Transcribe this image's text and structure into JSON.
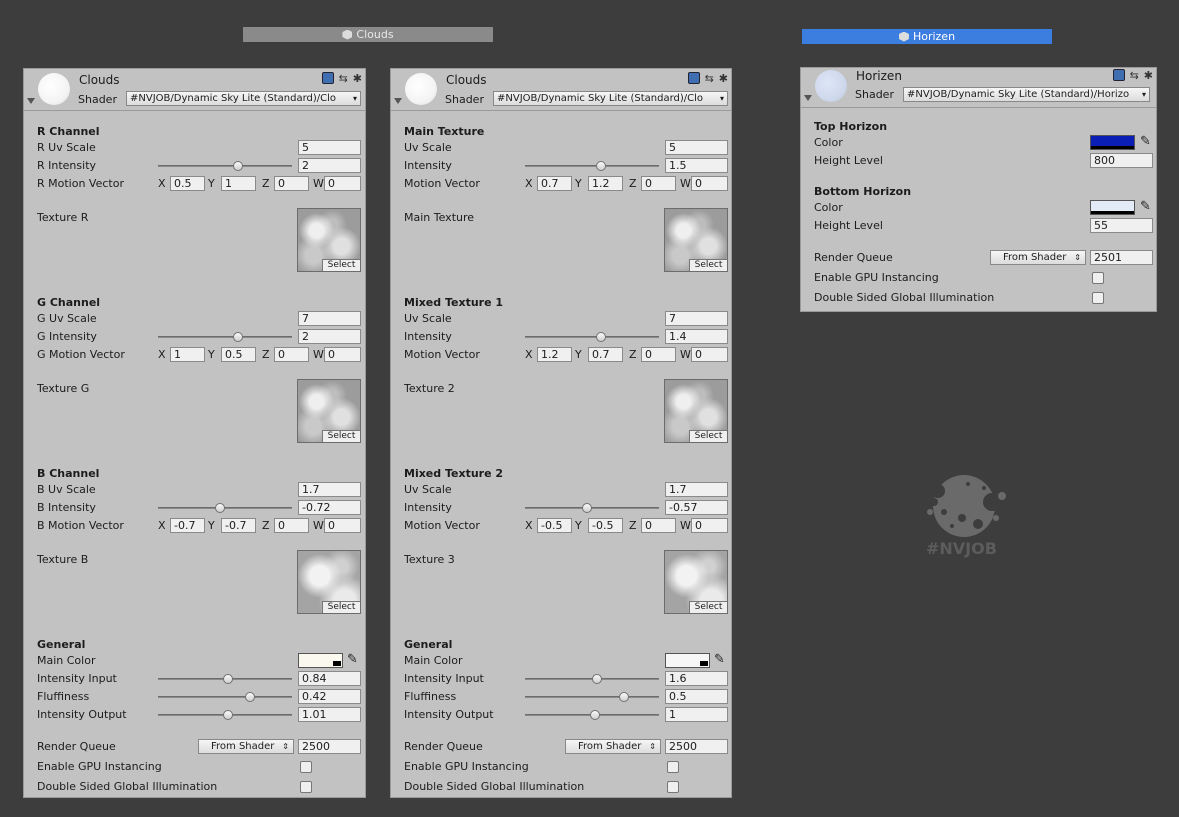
{
  "headers": [
    {
      "label": "Clouds"
    },
    {
      "label": "Horizen"
    }
  ],
  "panels": [
    {
      "name": "Clouds",
      "shader_label": "Shader",
      "shader": "#NVJOB/Dynamic Sky Lite (Standard)/Clo",
      "sections": [
        {
          "title": "R Channel",
          "uv_label": "R Uv Scale",
          "uv": "5",
          "int_label": "R Intensity",
          "int": "2",
          "int_frac": 0.6,
          "mv_label": "R Motion Vector",
          "mv": [
            "0.5",
            "1",
            "0",
            "0"
          ],
          "tex_label": "Texture R",
          "tex_style": "a",
          "select": "Select"
        },
        {
          "title": "G Channel",
          "uv_label": "G Uv Scale",
          "uv": "7",
          "int_label": "G Intensity",
          "int": "2",
          "int_frac": 0.6,
          "mv_label": "G Motion Vector",
          "mv": [
            "1",
            "0.5",
            "0",
            "0"
          ],
          "tex_label": "Texture G",
          "tex_style": "a",
          "select": "Select"
        },
        {
          "title": "B Channel",
          "uv_label": "B Uv Scale",
          "uv": "1.7",
          "int_label": "B Intensity",
          "int": "-0.72",
          "int_frac": 0.46,
          "mv_label": "B Motion Vector",
          "mv": [
            "-0.7",
            "-0.7",
            "0",
            "0"
          ],
          "tex_label": "Texture B",
          "tex_style": "b",
          "select": "Select"
        }
      ],
      "general": {
        "title": "General",
        "color_label": "Main Color",
        "color": "#fbf8ef",
        "sliders": [
          {
            "label": "Intensity Input",
            "value": "0.84",
            "frac": 0.52
          },
          {
            "label": "Fluffiness",
            "value": "0.42",
            "frac": 0.69
          },
          {
            "label": "Intensity Output",
            "value": "1.01",
            "frac": 0.52
          }
        ]
      },
      "render_queue_label": "Render Queue",
      "render_queue_mode": "From Shader",
      "render_queue": "2500",
      "gpu_label": "Enable GPU Instancing",
      "dsgi_label": "Double Sided Global Illumination"
    },
    {
      "name": "Clouds",
      "shader_label": "Shader",
      "shader": "#NVJOB/Dynamic Sky Lite (Standard)/Clo",
      "sections": [
        {
          "title": "Main Texture",
          "uv_label": "Uv Scale",
          "uv": "5",
          "int_label": "Intensity",
          "int": "1.5",
          "int_frac": 0.57,
          "mv_label": "Motion Vector",
          "mv": [
            "0.7",
            "1.2",
            "0",
            "0"
          ],
          "tex_label": "Main Texture",
          "tex_style": "a",
          "select": "Select"
        },
        {
          "title": "Mixed Texture 1",
          "uv_label": "Uv Scale",
          "uv": "7",
          "int_label": "Intensity",
          "int": "1.4",
          "int_frac": 0.57,
          "mv_label": "Motion Vector",
          "mv": [
            "1.2",
            "0.7",
            "0",
            "0"
          ],
          "tex_label": "Texture 2",
          "tex_style": "a",
          "select": "Select"
        },
        {
          "title": "Mixed Texture 2",
          "uv_label": "Uv Scale",
          "uv": "1.7",
          "int_label": "Intensity",
          "int": "-0.57",
          "int_frac": 0.46,
          "mv_label": "Motion Vector",
          "mv": [
            "-0.5",
            "-0.5",
            "0",
            "0"
          ],
          "tex_label": "Texture 3",
          "tex_style": "b",
          "select": "Select"
        }
      ],
      "general": {
        "title": "General",
        "color_label": "Main Color",
        "color": "#f7f7f7",
        "sliders": [
          {
            "label": "Intensity Input",
            "value": "1.6",
            "frac": 0.54
          },
          {
            "label": "Fluffiness",
            "value": "0.5",
            "frac": 0.74
          },
          {
            "label": "Intensity Output",
            "value": "1",
            "frac": 0.52
          }
        ]
      },
      "render_queue_label": "Render Queue",
      "render_queue_mode": "From Shader",
      "render_queue": "2500",
      "gpu_label": "Enable GPU Instancing",
      "dsgi_label": "Double Sided Global Illumination"
    }
  ],
  "horizon": {
    "name": "Horizen",
    "shader_label": "Shader",
    "shader": "#NVJOB/Dynamic Sky Lite (Standard)/Horizo",
    "top": {
      "title": "Top Horizon",
      "color_label": "Color",
      "color": "#0a1db4",
      "height_label": "Height Level",
      "height": "800"
    },
    "bottom": {
      "title": "Bottom Horizon",
      "color_label": "Color",
      "color": "#e3ebf9",
      "height_label": "Height Level",
      "height": "55"
    },
    "render_queue_label": "Render Queue",
    "render_queue_mode": "From Shader",
    "render_queue": "2501",
    "gpu_label": "Enable GPU Instancing",
    "dsgi_label": "Double Sided Global Illumination"
  },
  "logo_text": "#NVJOB",
  "icons": [
    "cube-icon",
    "help-book-icon",
    "preset-icon",
    "gear-icon",
    "eyedropper-icon",
    "foldout-arrow-icon",
    "dropdown-arrow-icon",
    "checkbox-icon",
    "sphere-preview-icon"
  ],
  "colors": {
    "background": "#3d3d3d",
    "panel": "#c2c2c2",
    "selected_header": "#3c7de0",
    "inactive_header": "#8a8a8a"
  }
}
